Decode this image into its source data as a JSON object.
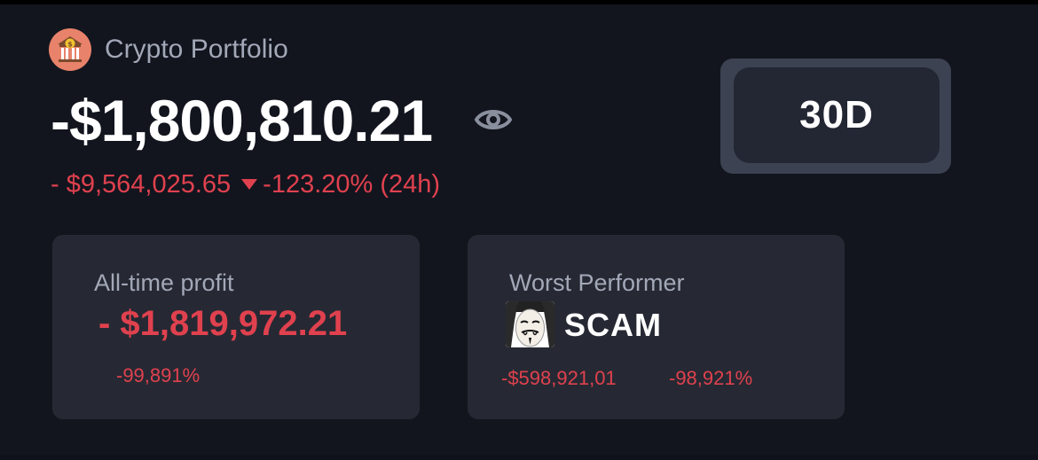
{
  "header": {
    "title": "Crypto Portfolio",
    "app_icon": "bank-icon"
  },
  "portfolio": {
    "balance": "-$1,800,810.21",
    "change_abs": "- $9,564,025.65",
    "change_pct": "-123.20% (24h)",
    "visibility_icon": "eye-icon",
    "trend_icon": "down-arrow-icon"
  },
  "time_range": {
    "selected": "30D"
  },
  "all_time_profit": {
    "label": "All-time profit",
    "value": "- $1,819,972.21",
    "percent": "-99,891%"
  },
  "worst_performer": {
    "label": "Worst Performer",
    "coin_name": "SCAM",
    "coin_icon": "anonymous-mask-icon",
    "loss": "-$598,921,01",
    "percent": "-98,921%"
  },
  "colors": {
    "background": "#12151e",
    "card": "#262933",
    "negative": "#e0414e",
    "muted_text": "#a3a8b8"
  }
}
